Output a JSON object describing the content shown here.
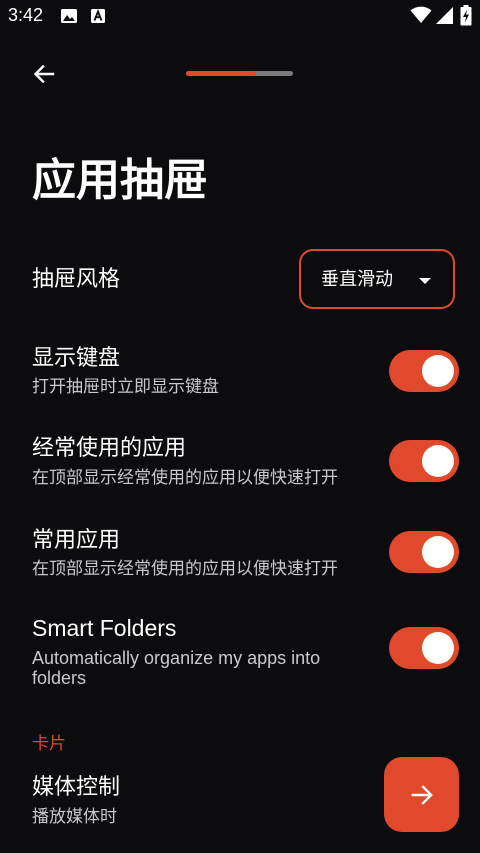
{
  "status_bar": {
    "time": "3:42",
    "icons": [
      "image-icon",
      "a-box-icon",
      "wifi-icon",
      "signal-icon",
      "battery-icon"
    ]
  },
  "top_bar": {
    "back_icon": "arrow-left-icon",
    "step_progress": 0.65
  },
  "page": {
    "title": "应用抽屉"
  },
  "drawer_style": {
    "label": "抽屉风格",
    "selected": "垂直滑动"
  },
  "settings": [
    {
      "title": "显示键盘",
      "subtitle": "打开抽屉时立即显示键盘",
      "enabled": true
    },
    {
      "title": "经常使用的应用",
      "subtitle": "在顶部显示经常使用的应用以便快速打开",
      "enabled": true
    },
    {
      "title": "常用应用",
      "subtitle": "在顶部显示经常使用的应用以便快速打开",
      "enabled": true
    },
    {
      "title": "Smart Folders",
      "subtitle": "Automatically organize my apps into folders",
      "enabled": true
    }
  ],
  "cards_section": {
    "header": "卡片",
    "media_control": {
      "title": "媒体控制",
      "subtitle": "播放媒体时",
      "action_icon": "arrow-right-icon"
    }
  },
  "colors": {
    "background": "#0c0c0e",
    "accent": "#e0492c",
    "text": "#ffffff",
    "secondary_text": "#c9c9cb"
  }
}
